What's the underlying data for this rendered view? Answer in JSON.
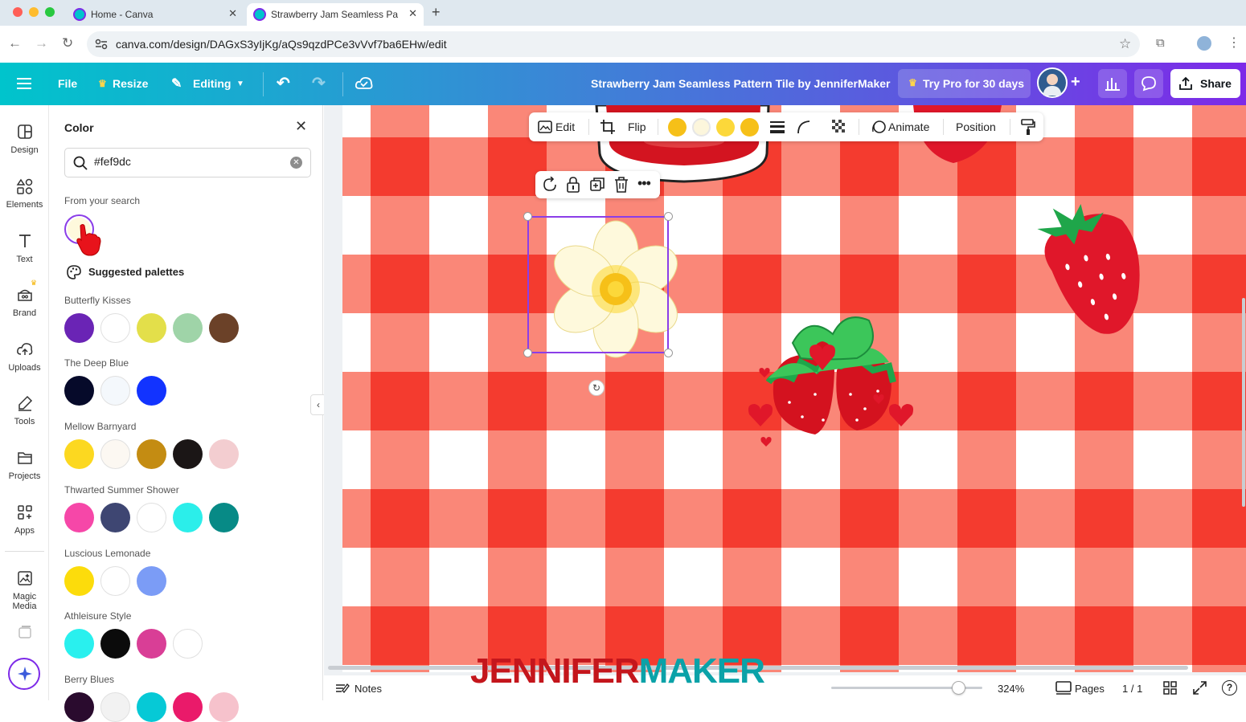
{
  "browser": {
    "tabs": [
      {
        "title": "Home - Canva"
      },
      {
        "title": "Strawberry Jam Seamless Pa"
      }
    ],
    "url": "canva.com/design/DAGxS3yIjKg/aQs9qzdPCe3vVvf7ba6EHw/edit"
  },
  "topbar": {
    "file": "File",
    "resize": "Resize",
    "editing": "Editing",
    "design_title": "Strawberry Jam Seamless Pattern Tile by JenniferMaker",
    "try_pro": "Try Pro for 30 days",
    "share": "Share"
  },
  "rail": {
    "items": [
      {
        "label": "Design",
        "icon": "design-icon"
      },
      {
        "label": "Elements",
        "icon": "elements-icon"
      },
      {
        "label": "Text",
        "icon": "text-icon"
      },
      {
        "label": "Brand",
        "icon": "brand-icon"
      },
      {
        "label": "Uploads",
        "icon": "uploads-icon"
      },
      {
        "label": "Tools",
        "icon": "tools-icon"
      },
      {
        "label": "Projects",
        "icon": "projects-icon"
      },
      {
        "label": "Apps",
        "icon": "apps-icon"
      },
      {
        "label": "Magic Media",
        "icon": "magic-media-icon"
      }
    ]
  },
  "panel": {
    "title": "Color",
    "search_value": "#fef9dc",
    "from_search_label": "From your search",
    "search_result_color": "#fef9dc",
    "suggested_label": "Suggested palettes",
    "palettes": [
      {
        "name": "Butterfly Kisses",
        "colors": [
          "#6a24b5",
          "#ffffff",
          "#e3df4a",
          "#9fd4a8",
          "#6b4128"
        ]
      },
      {
        "name": "The Deep Blue",
        "colors": [
          "#060a2a",
          "#f4f8fc",
          "#1233ff"
        ]
      },
      {
        "name": "Mellow Barnyard",
        "colors": [
          "#fcd820",
          "#fcf8f2",
          "#c48c12",
          "#1b1616",
          "#f3cdd0"
        ]
      },
      {
        "name": "Thwarted Summer Shower",
        "colors": [
          "#f647a8",
          "#3e4672",
          "#ffffff",
          "#2beeea",
          "#078a86"
        ]
      },
      {
        "name": "Luscious Lemonade",
        "colors": [
          "#fcdc0b",
          "#ffffff",
          "#7b9cf6"
        ]
      },
      {
        "name": "Athleisure Style",
        "colors": [
          "#29f0ee",
          "#0b0b0b",
          "#d93e96",
          "#ffffff"
        ]
      },
      {
        "name": "Berry Blues",
        "colors": [
          "#2a0b2e",
          "#f2f2f2",
          "#06c9d6",
          "#ea1a6a",
          "#f6c2cc"
        ]
      }
    ]
  },
  "context_toolbar": {
    "edit": "Edit",
    "flip": "Flip",
    "colors": [
      "#f6c018",
      "#fcf6dc",
      "#fcd83a",
      "#f6c018"
    ],
    "animate": "Animate",
    "position": "Position"
  },
  "bottombar": {
    "notes": "Notes",
    "zoom": "324%",
    "zoom_fraction": 0.84,
    "pages": "Pages",
    "page_count": "1 / 1"
  },
  "watermark": {
    "part1": "JENNIFER",
    "part2": "MAKER"
  },
  "colors": {
    "gingham_dark": "#f43b2f",
    "gingham_mid": "#fa8575",
    "gingham_light": "#ffffff",
    "accent_purple": "#8b3ee8"
  }
}
